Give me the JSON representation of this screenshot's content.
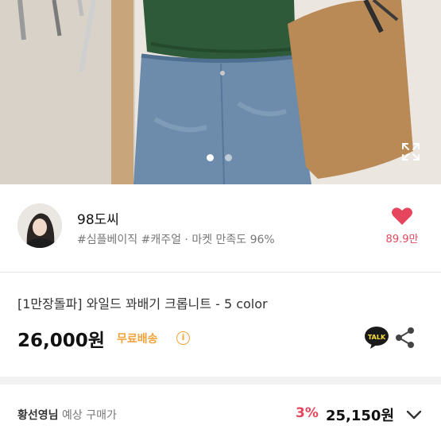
{
  "shop": {
    "name": "98도씨",
    "tag1": "#심플베이직",
    "tag2": "#캐주얼",
    "satisfaction": "· 마켓 만족도 96%",
    "likes": "89.9만"
  },
  "product": {
    "title": "[1만장돌파] 와일드 꽈배기 크롭니트 - 5 color",
    "price": "26,000원",
    "shipping": "무료배송",
    "talk_label": "TALK"
  },
  "buyer": {
    "name": "황선영님",
    "label": "예상 구매가",
    "discount": "3%",
    "final_price": "25,150원"
  },
  "colors": {
    "accent_red": "#e5465d",
    "shipping_orange": "#f2a33a"
  },
  "gallery": {
    "current": 1,
    "total": 2
  }
}
